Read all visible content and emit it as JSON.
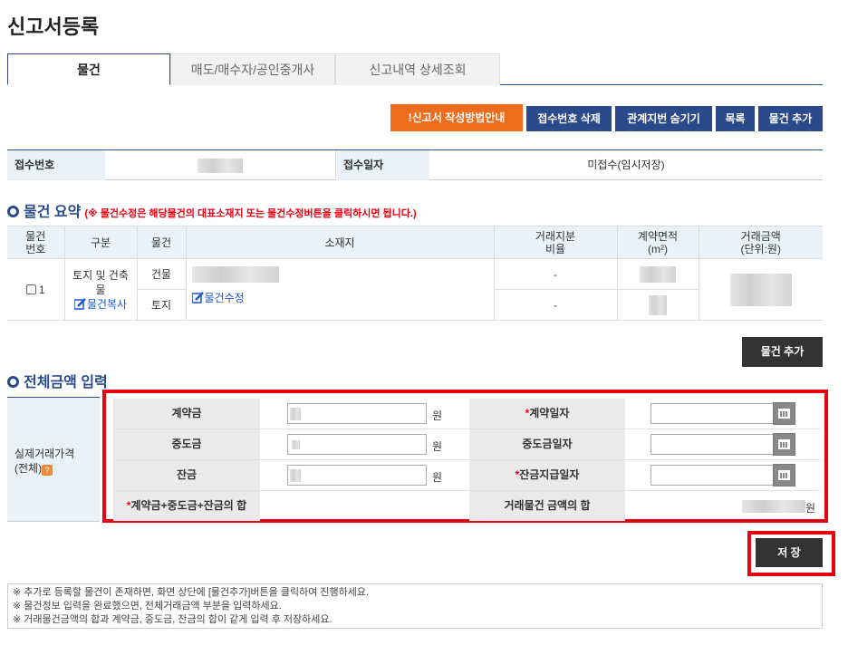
{
  "page_title": "신고서등록",
  "tabs": [
    {
      "label": "물건",
      "active": true
    },
    {
      "label": "매도/매수자/공인중개사"
    },
    {
      "label": "신고내역 상세조회"
    }
  ],
  "toolbar": {
    "guide_label": "!신고서 작성방법안내",
    "delete_receipt_label": "접수번호 삭제",
    "hide_lot_label": "관계지번 숨기기",
    "list_label": "목록",
    "add_property_label": "물건 추가"
  },
  "receipt": {
    "number_label": "접수번호",
    "date_label": "접수일자",
    "date_value": "미접수(임시저장)"
  },
  "summary": {
    "title": "물건 요약",
    "note": "(※ 물건수정은 해당물건의 대표소재지 또는 물건수정버튼을 클릭하시면 됩니다.)",
    "headers": {
      "no": "물건\n번호",
      "category": "구분",
      "item": "물건",
      "location": "소재지",
      "share": "거래지분\n비율",
      "area": "계약면적\n(m²)",
      "price": "거래금액\n(단위:원)"
    },
    "row": {
      "no": "1",
      "category": "토지 및 건축물",
      "copy_label": "물건복사",
      "item_building": "건물",
      "item_land": "토지",
      "edit_label": "물건수정",
      "share_building": "-",
      "share_land": "-"
    },
    "add_button": "물건 추가"
  },
  "amount": {
    "title": "전체금액 입력",
    "left_label_1": "실제거래가격",
    "left_label_2": "(전체)",
    "help": "?",
    "rows": [
      {
        "label": "계약금",
        "unit": "원",
        "date_label": "계약일자",
        "date_required": true
      },
      {
        "label": "중도금",
        "unit": "원",
        "date_label": "중도금일자",
        "date_required": false
      },
      {
        "label": "잔금",
        "unit": "원",
        "date_label": "잔금지급일자",
        "date_required": true
      }
    ],
    "sum_label": "계약금+중도금+잔금의 합",
    "total_label": "거래물건 금액의 합",
    "total_unit": "원",
    "save_label": "저 장"
  },
  "notes": [
    "※ 추가로 등록할 물건이 존재하면, 화면 상단에 [물건추가]버튼을 클릭하여 진행하세요.",
    "※ 물건정보 입력을 완료했으면, 전체거래금액 부분을 입력하세요.",
    "※ 거래물건금액의 합과 계약금, 중도금, 잔금의 합이 같게 입력 후 저장하세요."
  ],
  "colors": {
    "accent": "#2b4a8b",
    "orange": "#ef6b1e",
    "highlight": "#e60012"
  }
}
